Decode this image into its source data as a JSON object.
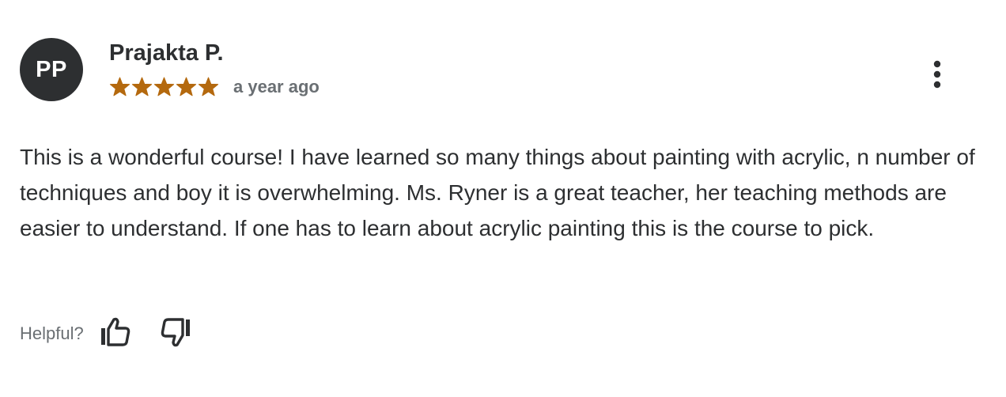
{
  "review": {
    "avatar_initials": "PP",
    "reviewer_name": "Prajakta P.",
    "rating": 5,
    "rating_max": 5,
    "time_ago": "a year ago",
    "text": "This is a wonderful course! I have learned so many things about painting with acrylic, n number of techniques and boy it is overwhelming. Ms. Ryner is a great teacher, her teaching methods are easier to understand. If one has to learn about acrylic painting this is the course to pick.",
    "helpful_label": "Helpful?"
  },
  "icons": {
    "menu": "more-vertical-icon",
    "thumbs_up": "thumbs-up-icon",
    "thumbs_down": "thumbs-down-icon",
    "star": "star-icon"
  },
  "colors": {
    "star": "#b4690e",
    "text": "#2d2f31",
    "muted": "#6a6f73",
    "avatar_bg": "#2d2f31"
  }
}
